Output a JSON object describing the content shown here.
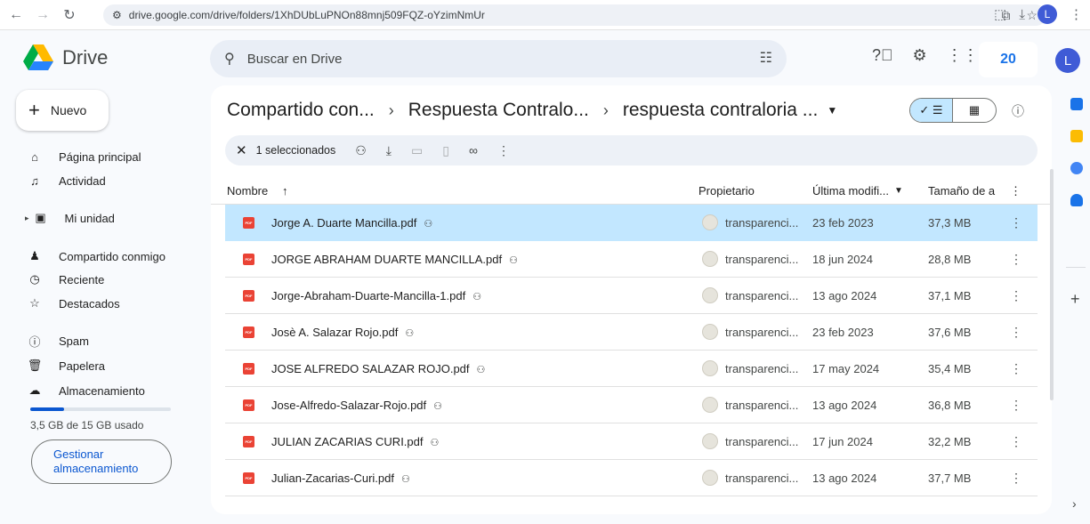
{
  "browser": {
    "url": "drive.google.com/drive/folders/1XhDUbLuPNOn88mnj509FQZ-oYzimNmUr",
    "profile_initial": "L"
  },
  "header": {
    "app_name": "Drive",
    "search_placeholder": "Buscar en Drive",
    "badge": "20",
    "avatar_initial": "L"
  },
  "sidebar": {
    "new_label": "Nuevo",
    "items": [
      {
        "label": "Página principal",
        "icon": "home-icon"
      },
      {
        "label": "Actividad",
        "icon": "bell-icon"
      },
      {
        "label": "Mi unidad",
        "icon": "drive-icon"
      },
      {
        "label": "Compartido conmigo",
        "icon": "people-icon"
      },
      {
        "label": "Reciente",
        "icon": "clock-icon"
      },
      {
        "label": "Destacados",
        "icon": "star-icon"
      },
      {
        "label": "Spam",
        "icon": "spam-icon"
      },
      {
        "label": "Papelera",
        "icon": "trash-icon"
      },
      {
        "label": "Almacenamiento",
        "icon": "cloud-icon"
      }
    ],
    "storage_text": "3,5 GB de 15 GB usado",
    "storage_used_fraction": 0.233,
    "manage_line1": "Gestionar",
    "manage_line2": "almacenamiento"
  },
  "main": {
    "breadcrumb": [
      "Compartido con...",
      "Respuesta Contralo...",
      "respuesta contraloria ..."
    ],
    "action_bar": {
      "selected_text": "1 seleccionados"
    },
    "columns": {
      "name": "Nombre",
      "owner": "Propietario",
      "modified": "Última modifi...",
      "size": "Tamaño de a"
    },
    "files": [
      {
        "name": "Jorge A. Duarte Mancilla.pdf",
        "owner": "transparenci...",
        "date": "23 feb 2023",
        "size": "37,3 MB",
        "selected": true
      },
      {
        "name": "JORGE ABRAHAM DUARTE MANCILLA.pdf",
        "owner": "transparenci...",
        "date": "18 jun 2024",
        "size": "28,8 MB",
        "selected": false
      },
      {
        "name": "Jorge-Abraham-Duarte-Mancilla-1.pdf",
        "owner": "transparenci...",
        "date": "13 ago 2024",
        "size": "37,1 MB",
        "selected": false
      },
      {
        "name": "Josè A. Salazar Rojo.pdf",
        "owner": "transparenci...",
        "date": "23 feb 2023",
        "size": "37,6 MB",
        "selected": false
      },
      {
        "name": "JOSE ALFREDO SALAZAR ROJO.pdf",
        "owner": "transparenci...",
        "date": "17 may 2024",
        "size": "35,4 MB",
        "selected": false
      },
      {
        "name": "Jose-Alfredo-Salazar-Rojo.pdf",
        "owner": "transparenci...",
        "date": "13 ago 2024",
        "size": "36,8 MB",
        "selected": false
      },
      {
        "name": "JULIAN ZACARIAS CURI.pdf",
        "owner": "transparenci...",
        "date": "17 jun 2024",
        "size": "32,2 MB",
        "selected": false
      },
      {
        "name": "Julian-Zacarias-Curi.pdf",
        "owner": "transparenci...",
        "date": "13 ago 2024",
        "size": "37,7 MB",
        "selected": false
      }
    ]
  },
  "colors": {
    "selected_row": "#c2e7ff",
    "accent": "#0b57d0",
    "pdf": "#ea4335"
  }
}
